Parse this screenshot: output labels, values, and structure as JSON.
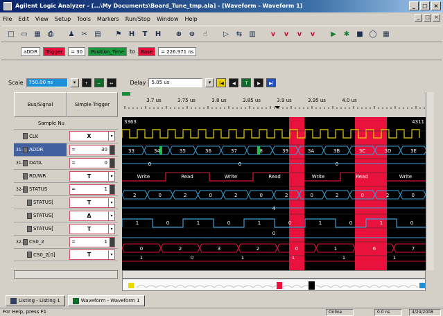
{
  "window": {
    "title": "Agilent Logic Analyzer - [...\\My Documents\\Board_Tune_tmp.ala] - [Waveform - Waveform 1]",
    "buttons": [
      "_",
      "□",
      "×"
    ],
    "mdi_buttons": [
      "_",
      "□",
      "×"
    ]
  },
  "menu": [
    "File",
    "Edit",
    "View",
    "Setup",
    "Tools",
    "Markers",
    "Run/Stop",
    "Window",
    "Help"
  ],
  "toolbar": {
    "icons": [
      "new-icon",
      "open-icon",
      "save-icon",
      "print-icon",
      "find-icon",
      "cut-icon",
      "paste-icon",
      "marker-icon",
      "h-icon",
      "t-icon",
      "hb-icon",
      "zoom-in-icon",
      "zoom-out-icon",
      "pan-icon",
      "goto-icon",
      "sync-icon",
      "chart-icon",
      "trig1-icon",
      "trig2-icon",
      "trig3-icon",
      "trig4-icon",
      "run-icon",
      "run-repeat-icon",
      "stop-icon",
      "misc1-icon",
      "misc2-icon"
    ],
    "glyphs": [
      "□",
      "▭",
      "▦",
      "⎙",
      "♟",
      "✂",
      "▤",
      "⚑",
      "H",
      "T",
      "H",
      "⊕",
      "⊖",
      "☝",
      "▷",
      "⇆",
      "▥",
      "ⅴ",
      "ⅴ",
      "ⅴ",
      "ⅴ",
      "▶",
      "✱",
      "■",
      "◯",
      "▦"
    ]
  },
  "markers": {
    "m1_signal": "aDDR",
    "m1_name": "Trigger",
    "m1_expr": "= 30",
    "m2_name": "Position_Time",
    "m2_to": "to",
    "m2_ref": "Base",
    "m2_value": "= 226.971 ns"
  },
  "scale": {
    "scale_label": "Scale",
    "scale_value": "750.00 ns",
    "delay_label": "Delay",
    "delay_value": "5.05 us"
  },
  "columns": {
    "signal": "Bus/Signal",
    "trigger": "Simple Trigger"
  },
  "signals": [
    {
      "prefix": "",
      "name": "Sample Nu",
      "trig": "",
      "sel": false
    },
    {
      "prefix": "",
      "name": "CLK",
      "trig": "X",
      "sel": false
    },
    {
      "prefix": "31-",
      "name": "ADDR",
      "trig": "30",
      "sel": true
    },
    {
      "prefix": "31-",
      "name": "DATA",
      "trig": "0",
      "sel": false
    },
    {
      "prefix": "",
      "name": "RD/WR",
      "trig": "T",
      "sel": false
    },
    {
      "prefix": "32-",
      "name": "STATUS",
      "trig": "1",
      "sel": false
    },
    {
      "prefix": "",
      "name": "STATUS[",
      "trig": "T",
      "sel": false
    },
    {
      "prefix": "",
      "name": "STATUS[",
      "trig": "Δ",
      "sel": false
    },
    {
      "prefix": "",
      "name": "STATUS[",
      "trig": "T",
      "sel": false
    },
    {
      "prefix": "32-",
      "name": "CS0_2",
      "trig": "1",
      "sel": false
    },
    {
      "prefix": "",
      "name": "CS0_2[0]",
      "trig": "T",
      "sel": false
    }
  ],
  "timeline": {
    "ticks": [
      "3.7 us",
      "3.75 us",
      "3.8 us",
      "3.85 us",
      "3.9 us",
      "3.95 us",
      "4.0 us"
    ],
    "sample_start": "3363",
    "sample_end": "4311"
  },
  "buses": {
    "addr": [
      "33",
      "34",
      "35",
      "36",
      "37",
      "38",
      "39",
      "3A",
      "3B",
      "3C",
      "3D",
      "3E"
    ],
    "data": [
      "0",
      "0",
      "0"
    ],
    "rdwr": [
      "Write",
      "Read",
      "Write",
      "Read",
      "Write",
      "Read",
      "Write"
    ],
    "status": [
      "2",
      "0",
      "2",
      "0",
      "2",
      "0",
      "2",
      "0",
      "2",
      "0",
      "2",
      "0"
    ],
    "status_mid": "4",
    "status2_pulses": [
      "1",
      "0",
      "1",
      "0",
      "1",
      "0",
      "1",
      "0",
      "1",
      "0"
    ],
    "status3": "0",
    "cs": [
      "0",
      "2",
      "3",
      "2",
      "0",
      "1",
      "6",
      "7"
    ],
    "cs_low": [
      "1",
      "0",
      "1",
      "1",
      "1",
      "1"
    ]
  },
  "tabs": [
    "Listing - Listing 1",
    "Waveform - Waveform 1"
  ],
  "statusbar": {
    "left": "For Help, press F1",
    "right1": "Online",
    "right2": "0.0 ns",
    "right3": "4/24/2008"
  },
  "colors": {
    "trigger_red": "#e8123c",
    "clock": "#e8d800",
    "bus": "#3aa0d8",
    "rdwr": "#e8123c",
    "active_green": "#1fc04a"
  }
}
